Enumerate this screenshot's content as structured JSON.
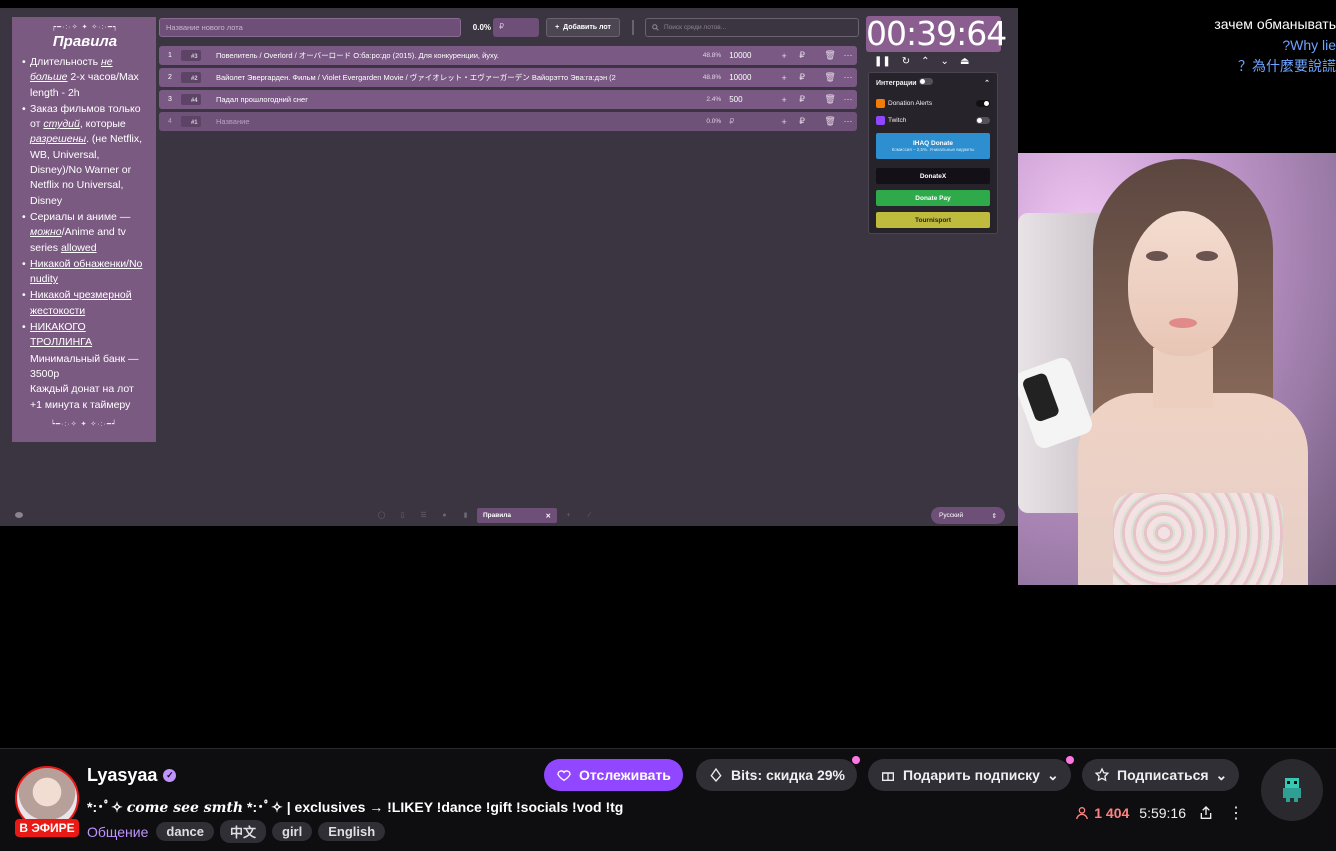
{
  "rules_panel": {
    "deco_top": "┍━·:·✧ ✦ ✧·:·━┑",
    "title": "Правила",
    "rules": [
      {
        "pre": "Длительность ",
        "em": "не больше",
        "post": " 2-х часов/Max length - 2h"
      },
      {
        "pre": "Заказ фильмов только от ",
        "em": "студий",
        "post": ", которые ",
        "em2": "разрешены",
        "post2": ". (не Netflix, WB, Universal, Disney)/No Warner or Netflix no Universal, Disney"
      },
      {
        "pre": "Сериалы и аниме — ",
        "em": "можно",
        "post": "/Anime and tv series ",
        "u": "allowed"
      },
      {
        "u": "Никакой обнаженки/No nudity"
      },
      {
        "u": "Никакой чрезмерной жестокости"
      },
      {
        "u": "НИКАКОГО ТРОЛЛИНГА"
      }
    ],
    "note1": "Минимальный банк — 3500р",
    "note2": "Каждый донат на лот +1 минута к таймеру",
    "deco_bottom": "┕━·:·✧ ✦ ✧·:·━┙"
  },
  "topbar": {
    "lot_placeholder": "Название нового лота",
    "pct": "0.0%",
    "amount_placeholder": "₽",
    "add_lot": "Добавить лот",
    "search_placeholder": "Поиск среди лотов..."
  },
  "lots": [
    {
      "num": "1",
      "tag": "#3",
      "name": "Повелитель / Overlord / オーバーロード O:ба:ро:до (2015). Для конкуренции, йуху.",
      "pct": "48.8%",
      "amount": "10000"
    },
    {
      "num": "2",
      "tag": "#2",
      "name": "Вайолет Эвергарден. Фильм / Violet Evergarden Movie / ヴァイオレット・エヴァーガーデン Вайорэтто Эва:га:дэн (2",
      "pct": "48.8%",
      "amount": "10000"
    },
    {
      "num": "3",
      "tag": "#4",
      "name": "Падал прошлогодний снег",
      "pct": "2.4%",
      "amount": "500"
    },
    {
      "num": "4",
      "tag": "#1",
      "name": "Название",
      "pct": "0.0%",
      "amount": "₽"
    }
  ],
  "timer": "00:39:64",
  "integrations": {
    "title": "Интеграции",
    "donation_alerts": "Donation Alerts",
    "twitch": "Twitch",
    "ihaq": "IHAQ Donate",
    "ihaq_sub": "Комиссия – 2,5%. Уникальные виджеты",
    "donatex": "DonateX",
    "donatepay": "Donate Pay",
    "tournisport": "Tournisport"
  },
  "bottombar": {
    "rules_tab": "Правила",
    "language": "Русский"
  },
  "overlay_chat": [
    "зачем обманывать",
    "?Why lie",
    "？為什麼要說謊"
  ],
  "channel": {
    "name": "Lyasyaa",
    "live": "В ЭФИРЕ",
    "title_prefix": "*:･ﾟ✧",
    "title_italic": "come see smth",
    "title_suffix": "*:･ﾟ✧ | exclusives → !LIKEY !dance !gift !socials !vod !tg",
    "category": "Общение",
    "tags": [
      "dance",
      "中文",
      "girl",
      "English"
    ],
    "follow": "Отслеживать",
    "bits": "Bits: скидка 29%",
    "gift": "Подарить подписку",
    "subscribe": "Подписаться",
    "viewers": "1 404",
    "uptime": "5:59:16"
  },
  "colors": {
    "accent": "#9147ff",
    "live": "#e91916",
    "app_bg": "#3a3540",
    "lot_row": "#7a5a84"
  }
}
